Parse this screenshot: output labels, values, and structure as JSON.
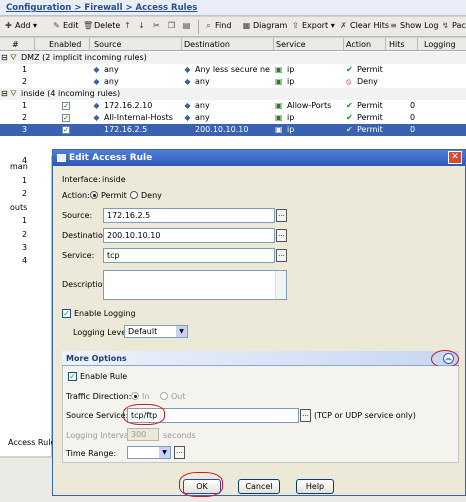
{
  "breadcrumb": {
    "text": "Configuration > Firewall > Access Rules"
  },
  "toolbar": {
    "add": "Add",
    "edit": "Edit",
    "delete": "Delete",
    "find": "Find",
    "diagram": "Diagram",
    "export": "Export",
    "clear_hits": "Clear Hits",
    "show_log": "Show Log",
    "packet_trace": "Packet Trace"
  },
  "table": {
    "columns": [
      "#",
      "Enabled",
      "Source",
      "Destination",
      "Service",
      "Action",
      "Hits",
      "Logging"
    ],
    "groups": [
      {
        "label": "DMZ (2 implicit incoming rules)",
        "rows": [
          {
            "num": "1",
            "source": "any",
            "destination": "Any less secure ne...",
            "service": "ip",
            "action": "Permit",
            "hits": "",
            "enabled": false
          },
          {
            "num": "2",
            "source": "any",
            "destination": "any",
            "service": "ip",
            "action": "Deny",
            "hits": "",
            "enabled": false
          }
        ]
      },
      {
        "label": "inside (4 incoming rules)",
        "rows": [
          {
            "num": "1",
            "source": "172.16.2.10",
            "destination": "any",
            "service": "Allow-Ports",
            "action": "Permit",
            "hits": "0",
            "enabled": true
          },
          {
            "num": "2",
            "source": "All-Internal-Hosts",
            "destination": "any",
            "service": "ip",
            "action": "Permit",
            "hits": "0",
            "enabled": true
          },
          {
            "num": "3",
            "source": "172.16.2.5",
            "destination": "200.10.10.10",
            "service": "ip",
            "action": "Permit",
            "hits": "0",
            "enabled": true
          }
        ]
      }
    ],
    "partial_rows": [
      "4",
      "man",
      "1",
      "2",
      "outs",
      "1",
      "2",
      "3",
      "4"
    ],
    "footer_label": "Access Rule"
  },
  "dialog": {
    "title": "Edit Access Rule",
    "interface_label": "Interface:",
    "interface_value": "inside",
    "action_label": "Action:",
    "permit_label": "Permit",
    "deny_label": "Deny",
    "source_label": "Source:",
    "source_value": "172.16.2.5",
    "destination_label": "Destination",
    "destination_value": "200.10.10.10",
    "service_label": "Service:",
    "service_value": "tcp",
    "description_label": "Description:",
    "enable_logging_label": "Enable Logging",
    "logging_level_label": "Logging Level:",
    "logging_level_value": "Default",
    "more_options_label": "More Options",
    "enable_rule_label": "Enable Rule",
    "traffic_direction_label": "Traffic Direction:",
    "in_label": "In",
    "out_label": "Out",
    "source_service_label": "Source Service:",
    "source_service_value": "tcp/ftp",
    "source_service_hint": "(TCP or UDP service only)",
    "logging_interval_label": "Logging Interval:",
    "logging_interval_value": "300",
    "logging_interval_unit": "seconds",
    "time_range_label": "Time Range:",
    "ok_label": "OK",
    "cancel_label": "Cancel",
    "help_label": "Help"
  }
}
